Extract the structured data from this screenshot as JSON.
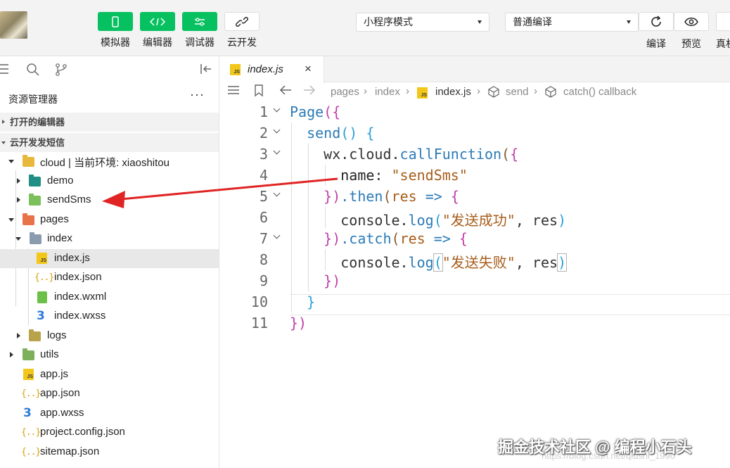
{
  "toolbar": {
    "buttons": [
      {
        "label": "模拟器",
        "icon": "phone-icon"
      },
      {
        "label": "编辑器",
        "icon": "code-icon"
      },
      {
        "label": "调试器",
        "icon": "sliders-icon"
      },
      {
        "label": "云开发",
        "icon": "cloud-link-icon"
      }
    ],
    "mode_select": "小程序模式",
    "compile_select": "普通编译",
    "actions": [
      {
        "label": "编译",
        "icon": "refresh-icon"
      },
      {
        "label": "预览",
        "icon": "eye-icon"
      },
      {
        "label": "真机",
        "icon": "device-icon"
      }
    ]
  },
  "sidebar": {
    "title": "资源管理器",
    "more": "···",
    "sections": {
      "open_editors": "打开的编辑器",
      "project": "云开发发短信"
    },
    "tree": [
      {
        "name": "cloud | 当前环境: xiaoshitou",
        "type": "cloud-folder",
        "expanded": true
      },
      {
        "name": "demo",
        "type": "cloud-function-folder",
        "expanded": false
      },
      {
        "name": "sendSms",
        "type": "cloud-function-folder",
        "expanded": false
      },
      {
        "name": "pages",
        "type": "folder",
        "expanded": true
      },
      {
        "name": "index",
        "type": "folder",
        "expanded": true
      },
      {
        "name": "index.js",
        "type": "js",
        "selected": true
      },
      {
        "name": "index.json",
        "type": "json"
      },
      {
        "name": "index.wxml",
        "type": "wxml"
      },
      {
        "name": "index.wxss",
        "type": "wxss"
      },
      {
        "name": "logs",
        "type": "folder",
        "expanded": false
      },
      {
        "name": "utils",
        "type": "folder",
        "expanded": false
      },
      {
        "name": "app.js",
        "type": "js"
      },
      {
        "name": "app.json",
        "type": "json"
      },
      {
        "name": "app.wxss",
        "type": "wxss"
      },
      {
        "name": "project.config.json",
        "type": "json"
      },
      {
        "name": "sitemap.json",
        "type": "json"
      }
    ]
  },
  "editor": {
    "tab": {
      "label": "index.js",
      "close": "×"
    },
    "breadcrumb": [
      "pages",
      "index",
      "index.js",
      "send",
      "catch() callback"
    ],
    "line_numbers": [
      "1",
      "2",
      "3",
      "4",
      "5",
      "6",
      "7",
      "8",
      "9",
      "10",
      "11"
    ],
    "code": {
      "l1_a": "Page",
      "l1_b": "({",
      "l2_a": "send",
      "l2_b": "()",
      "l2_c": " {",
      "l3_a": "wx.cloud.",
      "l3_b": "callFunction",
      "l3_c": "(",
      "l3_d": "{",
      "l4_a": "name",
      "l4_b": ": ",
      "l4_c": "\"sendSms\"",
      "l5_a": "})",
      "l5_b": ".then",
      "l5_c": "(",
      "l5_d": "res",
      "l5_e": " => ",
      "l5_f": "{",
      "l6_a": "console.",
      "l6_b": "log",
      "l6_c": "(",
      "l6_d": "\"发送成功\"",
      "l6_e": ", res",
      "l6_f": ")",
      "l7_a": "})",
      "l7_b": ".catch",
      "l7_c": "(",
      "l7_d": "res",
      "l7_e": " => ",
      "l7_f": "{",
      "l8_a": "console.",
      "l8_b": "log",
      "l8_c": "(",
      "l8_d": "\"发送失败\"",
      "l8_e": ", res",
      "l8_f": ")",
      "l9_a": "})",
      "l10_a": "}",
      "l11_a": "})"
    }
  },
  "watermark": "掘金技术社区 @ 编程小石头",
  "faint_url": "https://blog.csdn.net/qiushi_1990",
  "colors": {
    "accent_green": "#07c160",
    "annotation_red": "#e02424"
  }
}
